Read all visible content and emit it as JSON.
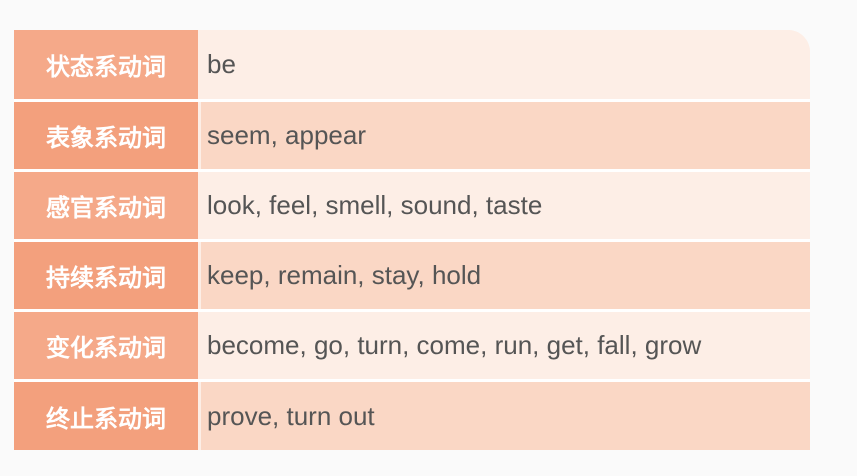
{
  "table": {
    "rows": [
      {
        "category": "状态系动词",
        "verbs": "be"
      },
      {
        "category": "表象系动词",
        "verbs": "seem, appear"
      },
      {
        "category": "感官系动词",
        "verbs": "look, feel, smell, sound, taste"
      },
      {
        "category": "持续系动词",
        "verbs": "keep, remain, stay, hold"
      },
      {
        "category": "变化系动词",
        "verbs": "become, go, turn, come, run, get, fall, grow"
      },
      {
        "category": "终止系动词",
        "verbs": "prove, turn out"
      }
    ]
  },
  "colors": {
    "label_bg": "#f4a582",
    "row_light": "#fdeee6",
    "row_dark": "#fad7c5",
    "text": "#555555"
  }
}
